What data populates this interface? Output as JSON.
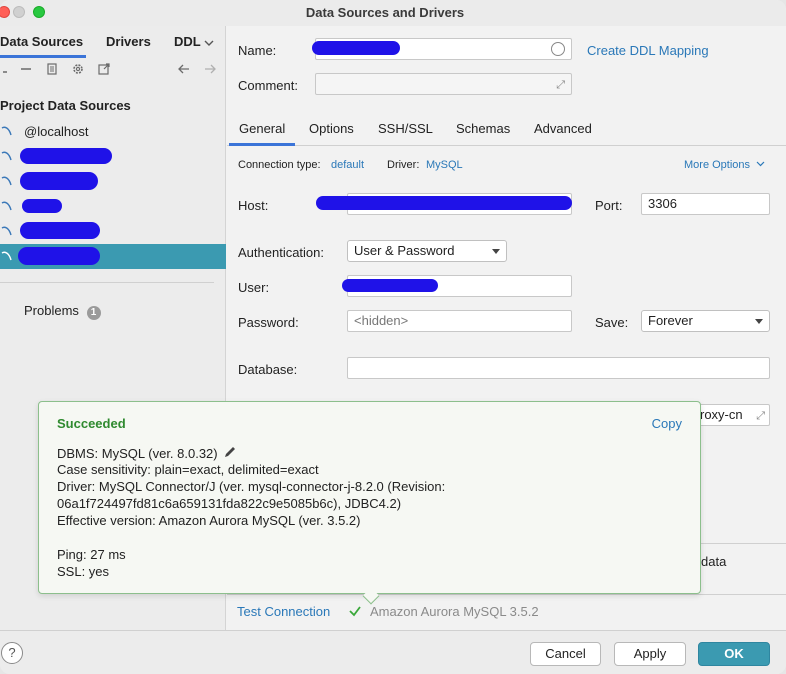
{
  "window": {
    "title": "Data Sources and Drivers"
  },
  "left": {
    "tabs": [
      "Data Sources",
      "Drivers",
      "DDL"
    ],
    "section_title": "Project Data Sources",
    "items": [
      {
        "label": "@localhost"
      }
    ],
    "problems_label": "Problems",
    "problems_count": "1"
  },
  "form": {
    "name_label": "Name:",
    "comment_label": "Comment:",
    "create_ddl_link": "Create DDL Mapping",
    "tabs": [
      "General",
      "Options",
      "SSH/SSL",
      "Schemas",
      "Advanced"
    ],
    "connection_type_label": "Connection type:",
    "connection_type_value": "default",
    "driver_label": "Driver:",
    "driver_value": "MySQL",
    "more_options": "More Options",
    "host_label": "Host:",
    "port_label": "Port:",
    "port_value": "3306",
    "auth_label": "Authentication:",
    "auth_value": "User & Password",
    "user_label": "User:",
    "password_label": "Password:",
    "password_placeholder": "<hidden>",
    "save_label": "Save:",
    "save_value": "Forever",
    "database_label": "Database:",
    "url_tail": "roxy-cn",
    "data_text": "data"
  },
  "popup": {
    "title": "Succeeded",
    "copy": "Copy",
    "lines": [
      "DBMS: MySQL (ver. 8.0.32)",
      "Case sensitivity: plain=exact, delimited=exact",
      "Driver: MySQL Connector/J (ver. mysql-connector-j-8.2.0 (Revision:",
      "06a1f724497fd81c6a659131fda822c9e5085b6c), JDBC4.2)",
      "Effective version: Amazon Aurora MySQL (ver. 3.5.2)",
      "Ping: 27 ms",
      "SSL: yes"
    ]
  },
  "test": {
    "link": "Test Connection",
    "result": "Amazon Aurora MySQL 3.5.2"
  },
  "buttons": {
    "cancel": "Cancel",
    "apply": "Apply",
    "ok": "OK",
    "help": "?"
  },
  "colors": {
    "accent": "#3b9ab1",
    "link": "#2a78b8",
    "success": "#2f8a2f",
    "redaction": "#1f12e8"
  }
}
